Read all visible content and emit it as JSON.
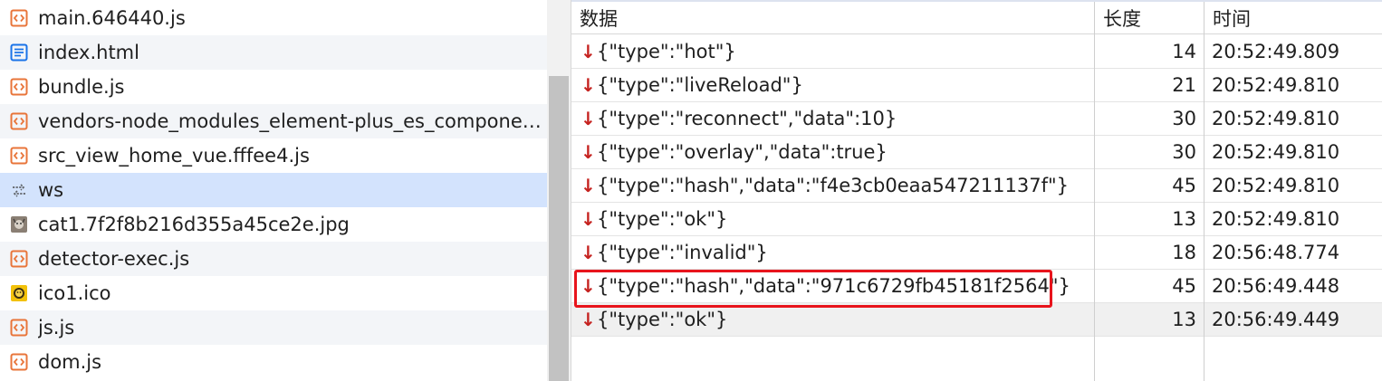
{
  "files": [
    {
      "name": "main.646440.js",
      "icon": "code-file-icon"
    },
    {
      "name": "index.html",
      "icon": "document-file-icon"
    },
    {
      "name": "bundle.js",
      "icon": "code-file-icon"
    },
    {
      "name": "vendors-node_modules_element-plus_es_compone…",
      "icon": "code-file-icon"
    },
    {
      "name": "src_view_home_vue.fffee4.js",
      "icon": "code-file-icon"
    },
    {
      "name": "ws",
      "icon": "websocket-icon",
      "selected": true
    },
    {
      "name": "cat1.7f2f8b216d355a45ce2e.jpg",
      "icon": "image-file-icon"
    },
    {
      "name": "detector-exec.js",
      "icon": "code-file-icon"
    },
    {
      "name": "ico1.ico",
      "icon": "favicon-icon"
    },
    {
      "name": "js.js",
      "icon": "code-file-icon"
    },
    {
      "name": "dom.js",
      "icon": "code-file-icon"
    }
  ],
  "table": {
    "headers": {
      "data": "数据",
      "length": "长度",
      "time": "时间"
    },
    "rows": [
      {
        "data": "{\"type\":\"hot\"}",
        "length": "14",
        "time": "20:52:49.809"
      },
      {
        "data": "{\"type\":\"liveReload\"}",
        "length": "21",
        "time": "20:52:49.810"
      },
      {
        "data": "{\"type\":\"reconnect\",\"data\":10}",
        "length": "30",
        "time": "20:52:49.810"
      },
      {
        "data": "{\"type\":\"overlay\",\"data\":true}",
        "length": "30",
        "time": "20:52:49.810"
      },
      {
        "data": "{\"type\":\"hash\",\"data\":\"f4e3cb0eaa547211137f\"}",
        "length": "45",
        "time": "20:52:49.810"
      },
      {
        "data": "{\"type\":\"ok\"}",
        "length": "13",
        "time": "20:52:49.810"
      },
      {
        "data": "{\"type\":\"invalid\"}",
        "length": "18",
        "time": "20:56:48.774"
      },
      {
        "data": "{\"type\":\"hash\",\"data\":\"971c6729fb45181f2564\"}",
        "length": "45",
        "time": "20:56:49.448",
        "annotated": true
      },
      {
        "data": "{\"type\":\"ok\"}",
        "length": "13",
        "time": "20:56:49.449",
        "highlighted": true
      }
    ]
  },
  "colors": {
    "selected_row": "#d3e3fd",
    "received_arrow": "#c5221f",
    "annotation_box": "#e8141c",
    "code_icon": "#e8753a",
    "doc_icon": "#1a73e8"
  }
}
